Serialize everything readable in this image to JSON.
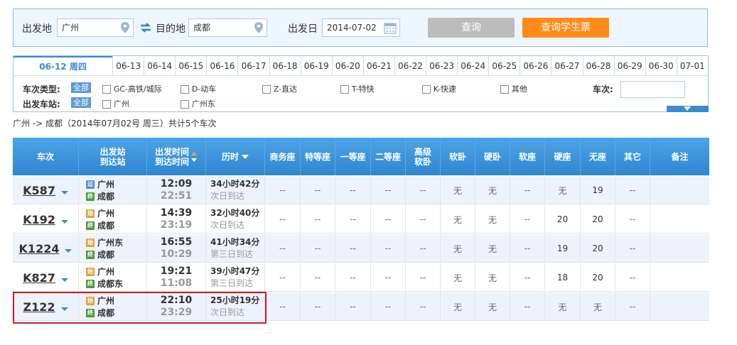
{
  "search": {
    "from_label": "出发地",
    "from_value": "广州",
    "to_label": "目的地",
    "to_value": "成都",
    "date_label": "出发日",
    "date_value": "2014-07-02",
    "query_button": "查询",
    "student_button": "查询学生票"
  },
  "dates": [
    {
      "label": "06-12 周四",
      "active": true
    },
    {
      "label": "06-13"
    },
    {
      "label": "06-14"
    },
    {
      "label": "06-15"
    },
    {
      "label": "06-16"
    },
    {
      "label": "06-17"
    },
    {
      "label": "06-18"
    },
    {
      "label": "06-19"
    },
    {
      "label": "06-20"
    },
    {
      "label": "06-21"
    },
    {
      "label": "06-22"
    },
    {
      "label": "06-23"
    },
    {
      "label": "06-24"
    },
    {
      "label": "06-25"
    },
    {
      "label": "06-26"
    },
    {
      "label": "06-27"
    },
    {
      "label": "06-28"
    },
    {
      "label": "06-29"
    },
    {
      "label": "06-30"
    },
    {
      "label": "07-01"
    }
  ],
  "filters": {
    "type_label": "车次类型:",
    "all_label": "全部",
    "types": [
      "GC-高铁/城际",
      "D-动车",
      "Z-直达",
      "T-特快",
      "K-快速",
      "其他"
    ],
    "train_no_label": "车次:",
    "station_label": "出发车站:",
    "stations": [
      "广州",
      "广州东"
    ]
  },
  "summary": "广州 -> 成都（2014年07月02号  周三）共计5个车次",
  "table": {
    "headers": {
      "train": "车次",
      "station1": "出发站",
      "station2": "到达站",
      "time1": "出发时间",
      "time2": "到达时间",
      "duration": "历时",
      "business": "商务座",
      "special": "特等座",
      "first": "一等座",
      "second": "二等座",
      "deluxe1": "高级",
      "deluxe2": "软卧",
      "soft_sleeper": "软卧",
      "hard_sleeper": "硬卧",
      "soft_seat": "软座",
      "hard_seat": "硬座",
      "no_seat": "无座",
      "other": "其它",
      "remark": "备注"
    },
    "rows": [
      {
        "train": "K587",
        "from": "广州",
        "from_icon": "过",
        "to": "成都",
        "to_icon": "终",
        "dep": "12:09",
        "arr": "22:51",
        "dur": "34小时42分",
        "arrive_note": "次日到达",
        "seats": [
          "--",
          "--",
          "--",
          "--",
          "--",
          "无",
          "无",
          "--",
          "无",
          "19",
          "--",
          ""
        ]
      },
      {
        "train": "K192",
        "from": "广州",
        "from_icon": "始",
        "to": "成都",
        "to_icon": "终",
        "dep": "14:39",
        "arr": "23:19",
        "dur": "32小时40分",
        "arrive_note": "次日到达",
        "seats": [
          "--",
          "--",
          "--",
          "--",
          "--",
          "无",
          "无",
          "--",
          "20",
          "20",
          "--",
          ""
        ]
      },
      {
        "train": "K1224",
        "from": "广州东",
        "from_icon": "始",
        "to": "成都",
        "to_icon": "终",
        "dep": "16:55",
        "arr": "10:29",
        "dur": "41小时34分",
        "arrive_note": "第三日到达",
        "seats": [
          "--",
          "--",
          "--",
          "--",
          "--",
          "无",
          "无",
          "--",
          "19",
          "20",
          "--",
          ""
        ]
      },
      {
        "train": "K827",
        "from": "广州",
        "from_icon": "始",
        "to": "成都东",
        "to_icon": "终",
        "dep": "19:21",
        "arr": "11:08",
        "dur": "39小时47分",
        "arrive_note": "第三日到达",
        "seats": [
          "--",
          "--",
          "--",
          "--",
          "--",
          "无",
          "无",
          "--",
          "18",
          "20",
          "--",
          ""
        ]
      },
      {
        "train": "Z122",
        "from": "广州",
        "from_icon": "始",
        "to": "成都",
        "to_icon": "终",
        "dep": "22:10",
        "arr": "23:29",
        "dur": "25小时19分",
        "arrive_note": "次日到达",
        "seats": [
          "--",
          "--",
          "--",
          "--",
          "--",
          "无",
          "无",
          "--",
          "无",
          "无",
          "--",
          ""
        ]
      }
    ]
  },
  "colors": {
    "accent": "#3b8ad3",
    "orange_button": "#ff8c1a",
    "highlight": "#d9191e"
  }
}
